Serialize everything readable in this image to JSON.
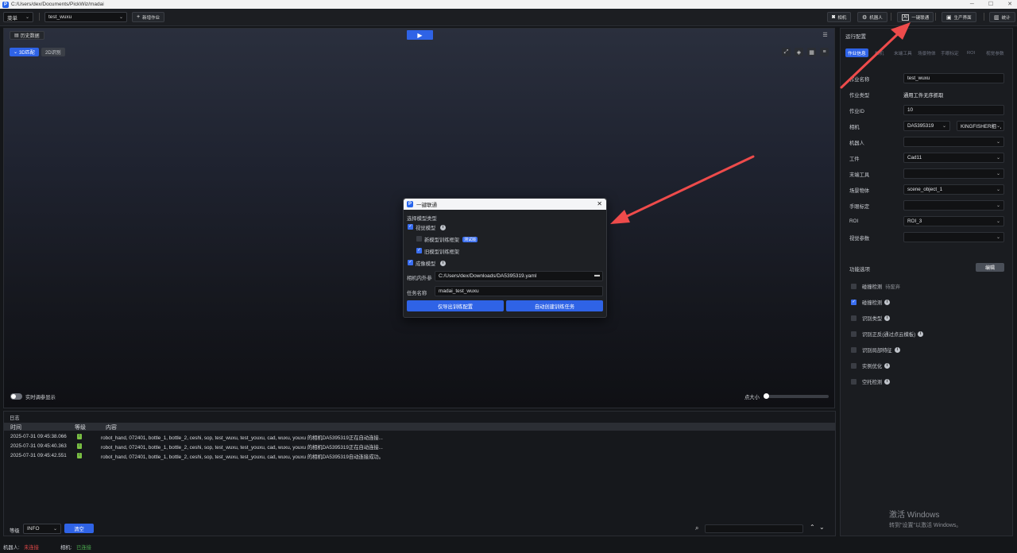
{
  "window": {
    "path": "C:/Users/dex/Documents/PickWiz/madai",
    "app_icon": "P"
  },
  "topbar": {
    "menu_label": "菜单",
    "job_select": "test_wuxu",
    "new_job": "新增作业",
    "camera": "相机",
    "robot": "机器人",
    "oneclick": "一键联通",
    "production": "生产界面",
    "stats": "统计"
  },
  "viewport": {
    "history": "历史数据",
    "tab_3d": "3D匹配",
    "tab_2d": "2D识别",
    "realtime": "实时调参显示",
    "point_size": "点大小"
  },
  "dialog": {
    "title": "一键联通",
    "select_type": "选择模型类型",
    "vision_model": "视觉模型",
    "new_framework": "新模型训练框架",
    "badge": "测试版",
    "old_framework": "旧模型训练框架",
    "imaging_model": "成像模型",
    "camera_params_label": "相机内外参",
    "camera_params_value": "C:/Users/dex/Downloads/DA5395319.yaml",
    "task_label": "任务名称",
    "task_value": "madai_test_wuxu",
    "export_btn": "仅导出训练配置",
    "auto_btn": "自动创建训练任务"
  },
  "right_panel": {
    "title": "运行配置",
    "tabs": [
      "作业信息",
      "相机",
      "末端工具",
      "场景物体",
      "手眼标定",
      "ROI",
      "视觉参数"
    ],
    "rows": [
      {
        "label": "作业名称",
        "value": "test_wuxu",
        "kind": "input"
      },
      {
        "label": "作业类型",
        "value": "通用工件无序抓取",
        "kind": "text"
      },
      {
        "label": "作业ID",
        "value": "10",
        "kind": "input"
      },
      {
        "label": "相机",
        "value": "DA5395319",
        "value2": "KINGFISHER相机",
        "kind": "double"
      },
      {
        "label": "机器人",
        "value": "",
        "kind": "select"
      },
      {
        "label": "工件",
        "value": "Cad11",
        "kind": "select"
      },
      {
        "label": "末端工具",
        "value": "",
        "kind": "select"
      },
      {
        "label": "场景物体",
        "value": "scene_object_1",
        "kind": "select"
      },
      {
        "label": "手眼标定",
        "value": "",
        "kind": "select"
      },
      {
        "label": "ROI",
        "value": "ROI_3",
        "kind": "select"
      },
      {
        "label": "视觉参数",
        "value": "",
        "kind": "select"
      }
    ],
    "func_title": "功能选项",
    "edit_btn": "编辑",
    "options": [
      {
        "label": "碰撞检测",
        "checked": false,
        "suffix": "待废弃",
        "info": false
      },
      {
        "label": "碰撞检测",
        "checked": true,
        "suffix": "",
        "info": true
      },
      {
        "label": "识别类型",
        "checked": false,
        "suffix": "",
        "info": true
      },
      {
        "label": "识别正反(通过点云模板)",
        "checked": false,
        "suffix": "",
        "info": true
      },
      {
        "label": "识别局部特征",
        "checked": false,
        "suffix": "",
        "info": true
      },
      {
        "label": "实例优化",
        "checked": false,
        "suffix": "",
        "info": true
      },
      {
        "label": "空托检测",
        "checked": false,
        "suffix": "",
        "info": true
      }
    ]
  },
  "log": {
    "title": "日志",
    "col_time": "时间",
    "col_level": "等级",
    "col_content": "内容",
    "rows": [
      {
        "time": "2025-07-31 09:45:38.066",
        "level": "I",
        "content": "robot_hand, 072401, bottle_1, bottle_2, ceshi, sop, test_wuxu, test_youxu, cad, wuxu, youxu 的相机DA5395319正在自动连接..."
      },
      {
        "time": "2025-07-31 09:45:40.363",
        "level": "I",
        "content": "robot_hand, 072401, bottle_1, bottle_2, ceshi, sop, test_wuxu, test_youxu, cad, wuxu, youxu 的相机DA5395319正在自动连接..."
      },
      {
        "time": "2025-07-31 09:45:42.551",
        "level": "I",
        "content": "robot_hand, 072401, bottle_1, bottle_2, ceshi, sop, test_wuxu, test_youxu, cad, wuxu, youxu 的相机DA5395319自动连接成功。"
      }
    ],
    "level_label": "等级",
    "level_value": "INFO",
    "clear_btn": "清空"
  },
  "status": {
    "robot_label": "机器人:",
    "robot_value": "未连接",
    "camera_label": "相机:",
    "camera_value": "已连接"
  },
  "watermark": {
    "line1": "激活 Windows",
    "line2": "转到\"设置\"以激活 Windows。"
  },
  "colors": {
    "accent": "#2f63e6",
    "arrow": "#ee4b4b",
    "disconnected": "#e04848",
    "connected": "#4caf50"
  }
}
